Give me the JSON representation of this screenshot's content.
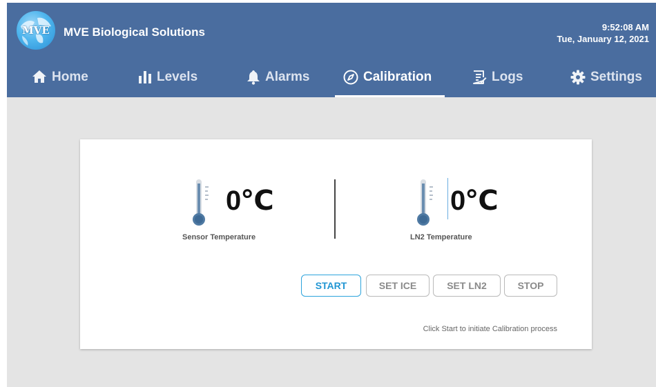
{
  "header": {
    "logo_text": "MVE",
    "company_name": "MVE Biological Solutions",
    "time": "9:52:08 AM",
    "date": "Tue, January 12, 2021"
  },
  "tabs": [
    {
      "label": "Home",
      "icon": "home-icon"
    },
    {
      "label": "Levels",
      "icon": "levels-icon"
    },
    {
      "label": "Alarms",
      "icon": "bell-icon"
    },
    {
      "label": "Calibration",
      "icon": "compass-icon",
      "active": true
    },
    {
      "label": "Logs",
      "icon": "log-icon"
    },
    {
      "label": "Settings",
      "icon": "gear-icon"
    }
  ],
  "calibration": {
    "sensor": {
      "value": "0℃",
      "label": "Sensor Temperature"
    },
    "ln2": {
      "value": "0℃",
      "label": "LN2 Temperature"
    },
    "buttons": {
      "start": "START",
      "set_ice": "SET ICE",
      "set_ln2": "SET LN2",
      "stop": "STOP"
    },
    "hint": "Click Start to initiate Calibration process"
  },
  "colors": {
    "header_bg": "#4a6d9f",
    "accent": "#2196d3",
    "page_bg": "#e4e4e4"
  }
}
